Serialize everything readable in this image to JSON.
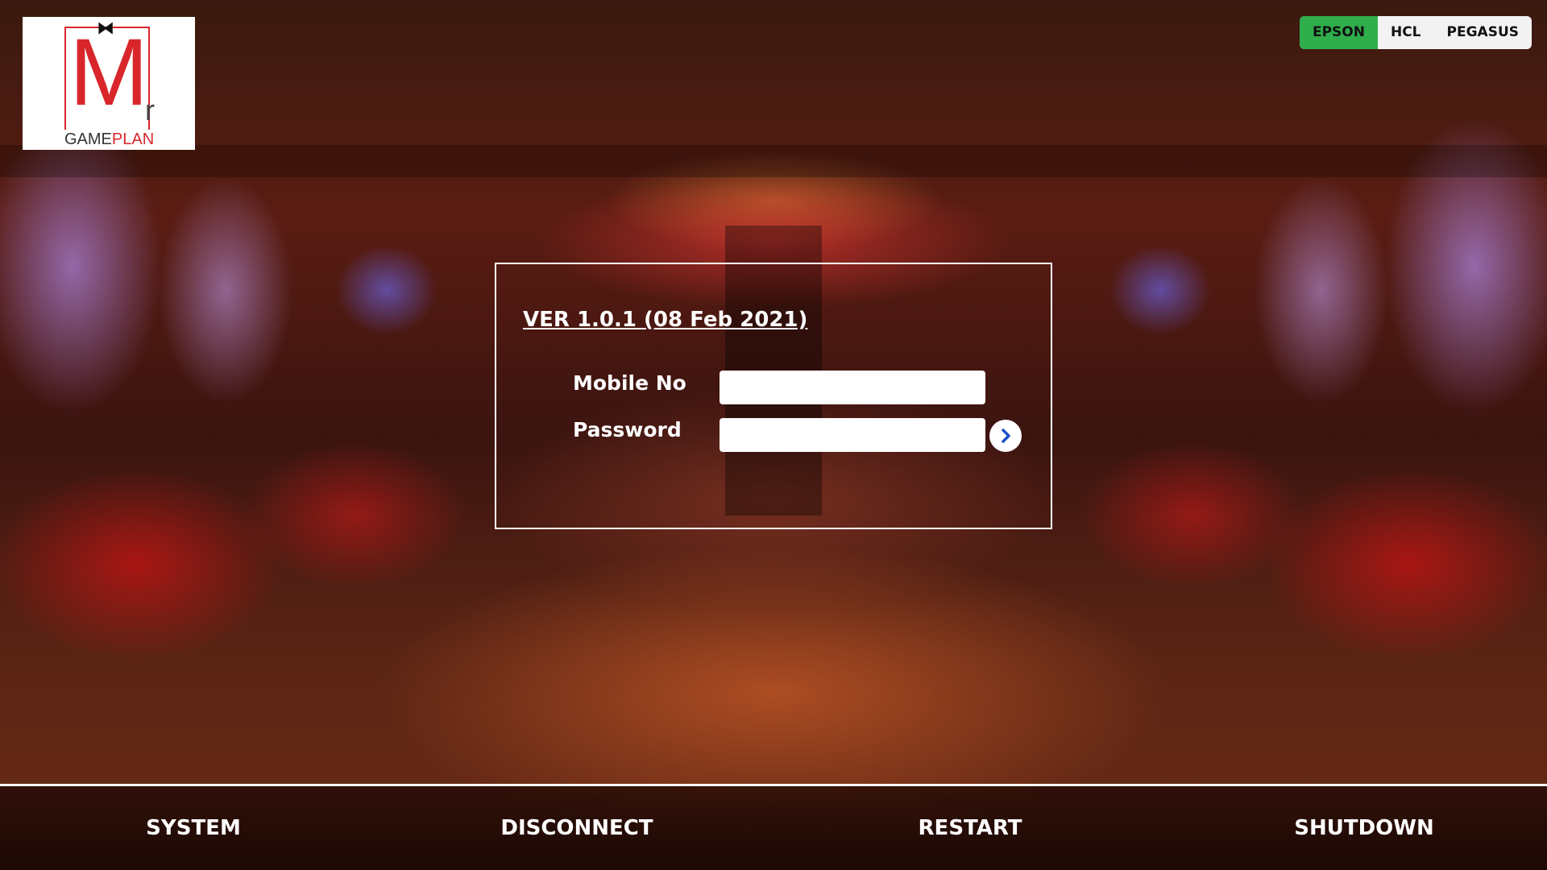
{
  "logo": {
    "letter": "M",
    "superscript": "r",
    "word_part1": "GAME",
    "word_part2": "PLAN"
  },
  "printer_options": [
    {
      "label": "EPSON",
      "active": true
    },
    {
      "label": "HCL",
      "active": false
    },
    {
      "label": "PEGASUS",
      "active": false
    }
  ],
  "login": {
    "version": "VER 1.0.1 (08 Feb 2021)",
    "mobile_label": "Mobile No",
    "mobile_value": "",
    "password_label": "Password",
    "password_value": "",
    "submit_icon": "chevron-right-icon"
  },
  "bottom_bar": {
    "system": "SYSTEM",
    "disconnect": "DISCONNECT",
    "restart": "RESTART",
    "shutdown": "SHUTDOWN"
  },
  "colors": {
    "active_printer": "#2fae4b",
    "logo_red": "#d8262b",
    "submit_icon": "#1d4fc4"
  }
}
